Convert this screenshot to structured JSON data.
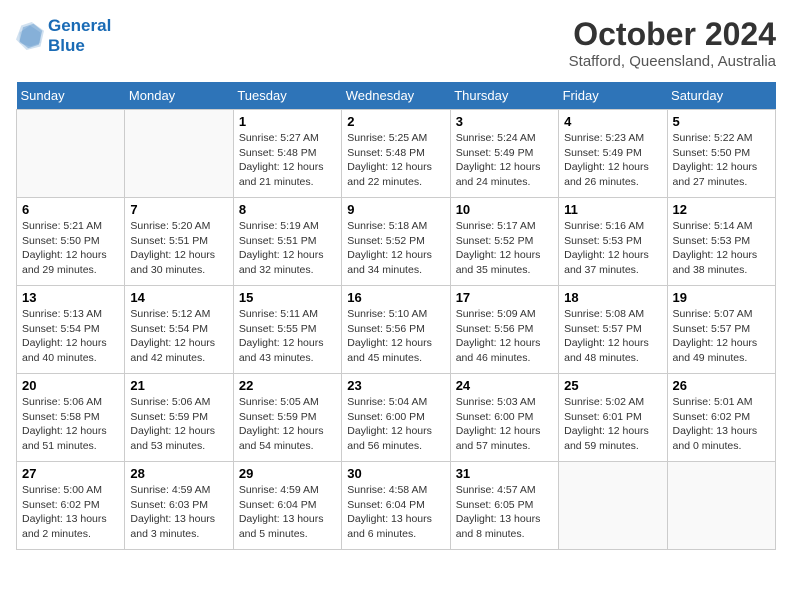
{
  "header": {
    "logo_line1": "General",
    "logo_line2": "Blue",
    "month_year": "October 2024",
    "location": "Stafford, Queensland, Australia"
  },
  "weekdays": [
    "Sunday",
    "Monday",
    "Tuesday",
    "Wednesday",
    "Thursday",
    "Friday",
    "Saturday"
  ],
  "weeks": [
    [
      {
        "day": "",
        "info": ""
      },
      {
        "day": "",
        "info": ""
      },
      {
        "day": "1",
        "info": "Sunrise: 5:27 AM\nSunset: 5:48 PM\nDaylight: 12 hours and 21 minutes."
      },
      {
        "day": "2",
        "info": "Sunrise: 5:25 AM\nSunset: 5:48 PM\nDaylight: 12 hours and 22 minutes."
      },
      {
        "day": "3",
        "info": "Sunrise: 5:24 AM\nSunset: 5:49 PM\nDaylight: 12 hours and 24 minutes."
      },
      {
        "day": "4",
        "info": "Sunrise: 5:23 AM\nSunset: 5:49 PM\nDaylight: 12 hours and 26 minutes."
      },
      {
        "day": "5",
        "info": "Sunrise: 5:22 AM\nSunset: 5:50 PM\nDaylight: 12 hours and 27 minutes."
      }
    ],
    [
      {
        "day": "6",
        "info": "Sunrise: 5:21 AM\nSunset: 5:50 PM\nDaylight: 12 hours and 29 minutes."
      },
      {
        "day": "7",
        "info": "Sunrise: 5:20 AM\nSunset: 5:51 PM\nDaylight: 12 hours and 30 minutes."
      },
      {
        "day": "8",
        "info": "Sunrise: 5:19 AM\nSunset: 5:51 PM\nDaylight: 12 hours and 32 minutes."
      },
      {
        "day": "9",
        "info": "Sunrise: 5:18 AM\nSunset: 5:52 PM\nDaylight: 12 hours and 34 minutes."
      },
      {
        "day": "10",
        "info": "Sunrise: 5:17 AM\nSunset: 5:52 PM\nDaylight: 12 hours and 35 minutes."
      },
      {
        "day": "11",
        "info": "Sunrise: 5:16 AM\nSunset: 5:53 PM\nDaylight: 12 hours and 37 minutes."
      },
      {
        "day": "12",
        "info": "Sunrise: 5:14 AM\nSunset: 5:53 PM\nDaylight: 12 hours and 38 minutes."
      }
    ],
    [
      {
        "day": "13",
        "info": "Sunrise: 5:13 AM\nSunset: 5:54 PM\nDaylight: 12 hours and 40 minutes."
      },
      {
        "day": "14",
        "info": "Sunrise: 5:12 AM\nSunset: 5:54 PM\nDaylight: 12 hours and 42 minutes."
      },
      {
        "day": "15",
        "info": "Sunrise: 5:11 AM\nSunset: 5:55 PM\nDaylight: 12 hours and 43 minutes."
      },
      {
        "day": "16",
        "info": "Sunrise: 5:10 AM\nSunset: 5:56 PM\nDaylight: 12 hours and 45 minutes."
      },
      {
        "day": "17",
        "info": "Sunrise: 5:09 AM\nSunset: 5:56 PM\nDaylight: 12 hours and 46 minutes."
      },
      {
        "day": "18",
        "info": "Sunrise: 5:08 AM\nSunset: 5:57 PM\nDaylight: 12 hours and 48 minutes."
      },
      {
        "day": "19",
        "info": "Sunrise: 5:07 AM\nSunset: 5:57 PM\nDaylight: 12 hours and 49 minutes."
      }
    ],
    [
      {
        "day": "20",
        "info": "Sunrise: 5:06 AM\nSunset: 5:58 PM\nDaylight: 12 hours and 51 minutes."
      },
      {
        "day": "21",
        "info": "Sunrise: 5:06 AM\nSunset: 5:59 PM\nDaylight: 12 hours and 53 minutes."
      },
      {
        "day": "22",
        "info": "Sunrise: 5:05 AM\nSunset: 5:59 PM\nDaylight: 12 hours and 54 minutes."
      },
      {
        "day": "23",
        "info": "Sunrise: 5:04 AM\nSunset: 6:00 PM\nDaylight: 12 hours and 56 minutes."
      },
      {
        "day": "24",
        "info": "Sunrise: 5:03 AM\nSunset: 6:00 PM\nDaylight: 12 hours and 57 minutes."
      },
      {
        "day": "25",
        "info": "Sunrise: 5:02 AM\nSunset: 6:01 PM\nDaylight: 12 hours and 59 minutes."
      },
      {
        "day": "26",
        "info": "Sunrise: 5:01 AM\nSunset: 6:02 PM\nDaylight: 13 hours and 0 minutes."
      }
    ],
    [
      {
        "day": "27",
        "info": "Sunrise: 5:00 AM\nSunset: 6:02 PM\nDaylight: 13 hours and 2 minutes."
      },
      {
        "day": "28",
        "info": "Sunrise: 4:59 AM\nSunset: 6:03 PM\nDaylight: 13 hours and 3 minutes."
      },
      {
        "day": "29",
        "info": "Sunrise: 4:59 AM\nSunset: 6:04 PM\nDaylight: 13 hours and 5 minutes."
      },
      {
        "day": "30",
        "info": "Sunrise: 4:58 AM\nSunset: 6:04 PM\nDaylight: 13 hours and 6 minutes."
      },
      {
        "day": "31",
        "info": "Sunrise: 4:57 AM\nSunset: 6:05 PM\nDaylight: 13 hours and 8 minutes."
      },
      {
        "day": "",
        "info": ""
      },
      {
        "day": "",
        "info": ""
      }
    ]
  ]
}
